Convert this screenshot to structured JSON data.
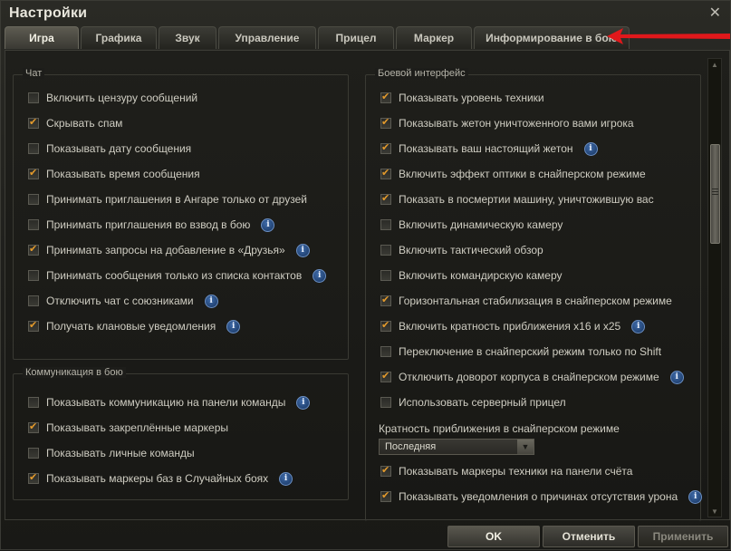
{
  "window": {
    "title": "Настройки",
    "close_label": "✕"
  },
  "tabs": [
    {
      "label": "Игра",
      "active": true
    },
    {
      "label": "Графика"
    },
    {
      "label": "Звук"
    },
    {
      "label": "Управление"
    },
    {
      "label": "Прицел"
    },
    {
      "label": "Маркер"
    },
    {
      "label": "Информирование в бою"
    }
  ],
  "chat": {
    "title": "Чат",
    "items": [
      {
        "label": "Включить цензуру сообщений",
        "checked": false,
        "info": false
      },
      {
        "label": "Скрывать спам",
        "checked": true,
        "info": false
      },
      {
        "label": "Показывать дату сообщения",
        "checked": false,
        "info": false
      },
      {
        "label": "Показывать время сообщения",
        "checked": true,
        "info": false
      },
      {
        "label": "Принимать приглашения в Ангаре только от друзей",
        "checked": false,
        "info": false
      },
      {
        "label": "Принимать приглашения во взвод в бою",
        "checked": false,
        "info": true
      },
      {
        "label": "Принимать запросы на добавление в «Друзья»",
        "checked": true,
        "info": true
      },
      {
        "label": "Принимать сообщения только из списка контактов",
        "checked": false,
        "info": true
      },
      {
        "label": "Отключить чат с союзниками",
        "checked": false,
        "info": true
      },
      {
        "label": "Получать клановые уведомления",
        "checked": true,
        "info": true
      }
    ]
  },
  "comms": {
    "title": "Коммуникация в бою",
    "items": [
      {
        "label": "Показывать коммуникацию на панели команды",
        "checked": false,
        "info": true
      },
      {
        "label": "Показывать закреплённые маркеры",
        "checked": true,
        "info": false
      },
      {
        "label": "Показывать личные команды",
        "checked": false,
        "info": false
      },
      {
        "label": "Показывать маркеры баз в Случайных боях",
        "checked": true,
        "info": true
      }
    ]
  },
  "battle": {
    "title": "Боевой интерфейс",
    "items": [
      {
        "label": "Показывать уровень техники",
        "checked": true,
        "info": false
      },
      {
        "label": "Показывать жетон уничтоженного вами игрока",
        "checked": true,
        "info": false
      },
      {
        "label": "Показывать ваш настоящий жетон",
        "checked": true,
        "info": true
      },
      {
        "label": "Включить эффект оптики в снайперском режиме",
        "checked": true,
        "info": false
      },
      {
        "label": "Показать в посмертии машину, уничтожившую вас",
        "checked": true,
        "info": false
      },
      {
        "label": "Включить динамическую камеру",
        "checked": false,
        "info": false
      },
      {
        "label": "Включить тактический обзор",
        "checked": false,
        "info": false
      },
      {
        "label": "Включить командирскую камеру",
        "checked": false,
        "info": false
      },
      {
        "label": "Горизонтальная стабилизация в снайперском режиме",
        "checked": true,
        "info": false
      },
      {
        "label": "Включить кратность приближения x16 и x25",
        "checked": true,
        "info": true
      },
      {
        "label": "Переключение в снайперский режим только по Shift",
        "checked": false,
        "info": false
      },
      {
        "label": "Отключить доворот корпуса в снайперском режиме",
        "checked": true,
        "info": true
      },
      {
        "label": "Использовать серверный прицел",
        "checked": false,
        "info": false
      }
    ],
    "zoom_label": "Кратность приближения в снайперском режиме",
    "zoom_value": "Последняя",
    "items_after": [
      {
        "label": "Показывать маркеры техники на панели счёта",
        "checked": true,
        "info": false
      },
      {
        "label": "Показывать уведомления о причинах отсутствия урона",
        "checked": true,
        "info": true
      }
    ]
  },
  "info_glyph": "i",
  "buttons": {
    "ok": "OK",
    "cancel": "Отменить",
    "apply": "Применить"
  },
  "colors": {
    "checkmark": "#e39a2c",
    "annotation_arrow": "#e0181b",
    "info_badge": "#2a5694"
  }
}
